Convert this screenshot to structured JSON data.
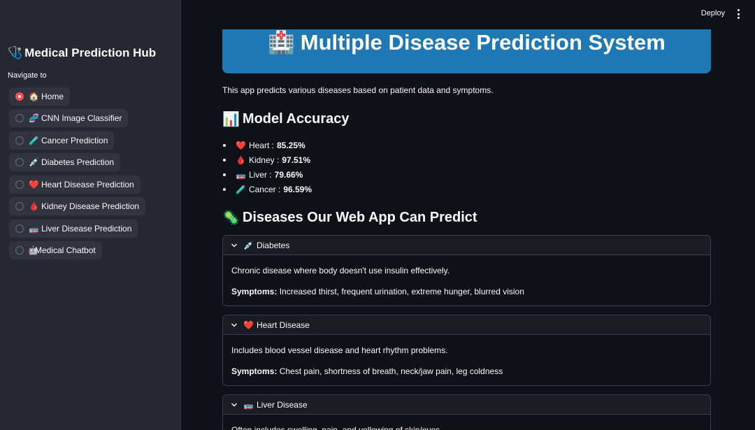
{
  "sidebar": {
    "title": "Medical Prediction Hub",
    "title_icon": "🩺",
    "nav_label": "Navigate to",
    "items": [
      {
        "icon": "🏠",
        "label": "Home",
        "selected": true
      },
      {
        "icon": "🧬",
        "label": "CNN Image Classifier",
        "selected": false
      },
      {
        "icon": "🧪",
        "label": "Cancer Prediction",
        "selected": false
      },
      {
        "icon": "💉",
        "label": "Diabetes Prediction",
        "selected": false
      },
      {
        "icon": "❤️",
        "label": "Heart Disease Prediction",
        "selected": false
      },
      {
        "icon": "🩸",
        "label": "Kidney Disease Prediction",
        "selected": false
      },
      {
        "icon": "🧫",
        "label": "Liver Disease Prediction",
        "selected": false
      },
      {
        "icon": "🤖",
        "label": "Medical Chatbot",
        "selected": false
      }
    ]
  },
  "header": {
    "deploy_label": "Deploy"
  },
  "main": {
    "title_icon": "🏥",
    "title": "Multiple Disease Prediction System",
    "intro": "This app predicts various diseases based on patient data and symptoms.",
    "accuracy_heading_icon": "📊",
    "accuracy_heading": "Model Accuracy",
    "accuracy": [
      {
        "icon": "❤️",
        "label": "Heart :",
        "value": "85.25%"
      },
      {
        "icon": "🩸",
        "label": "Kidney :",
        "value": "97.51%"
      },
      {
        "icon": "🧫",
        "label": "Liver :",
        "value": "79.66%"
      },
      {
        "icon": "🧪",
        "label": "Cancer :",
        "value": "96.59%"
      }
    ],
    "diseases_heading_icon": "🦠",
    "diseases_heading": "Diseases Our Web App Can Predict",
    "symptoms_label": "Symptoms:",
    "diseases": [
      {
        "icon": "💉",
        "name": "Diabetes",
        "description": "Chronic disease where body doesn't use insulin effectively.",
        "symptoms": "Increased thirst, frequent urination, extreme hunger, blurred vision"
      },
      {
        "icon": "❤️",
        "name": "Heart Disease",
        "description": "Includes blood vessel disease and heart rhythm problems.",
        "symptoms": "Chest pain, shortness of breath, neck/jaw pain, leg coldness"
      },
      {
        "icon": "🧫",
        "name": "Liver Disease",
        "description": "Often includes swelling, pain, and yellowing of skin/eyes.",
        "symptoms": ""
      }
    ]
  }
}
